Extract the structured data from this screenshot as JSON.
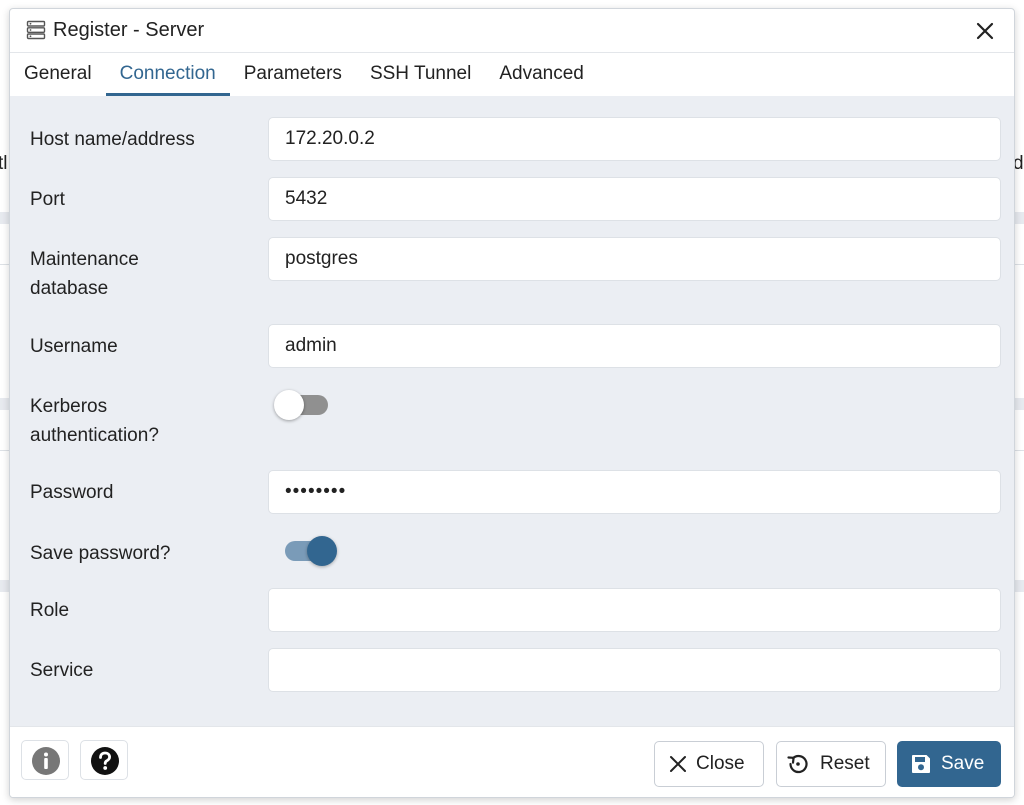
{
  "dialog": {
    "title": "Register - Server"
  },
  "tabs": [
    {
      "label": "General"
    },
    {
      "label": "Connection"
    },
    {
      "label": "Parameters"
    },
    {
      "label": "SSH Tunnel"
    },
    {
      "label": "Advanced"
    }
  ],
  "active_tab": "Connection",
  "background": {
    "left_fragment": "tl",
    "right_fragment": "d"
  },
  "form": {
    "host": {
      "label": "Host name/address",
      "value": "172.20.0.2"
    },
    "port": {
      "label": "Port",
      "value": "5432"
    },
    "maintenance_db": {
      "label_line1": "Maintenance",
      "label_line2": "database",
      "value": "postgres"
    },
    "username": {
      "label": "Username",
      "value": "admin"
    },
    "kerberos": {
      "label_line1": "Kerberos",
      "label_line2": "authentication?",
      "checked": false
    },
    "password": {
      "label": "Password",
      "value": "••••••••"
    },
    "save_password": {
      "label": "Save password?",
      "checked": true
    },
    "role": {
      "label": "Role",
      "value": ""
    },
    "service": {
      "label": "Service",
      "value": ""
    }
  },
  "footer": {
    "info_icon": "info-icon",
    "help_icon": "help-icon",
    "close_label": "Close",
    "reset_label": "Reset",
    "save_label": "Save"
  },
  "colors": {
    "accent": "#326690",
    "body_bg": "#ebeef3",
    "toggle_off_track": "#909090",
    "toggle_on_track": "#7a9bb8"
  }
}
